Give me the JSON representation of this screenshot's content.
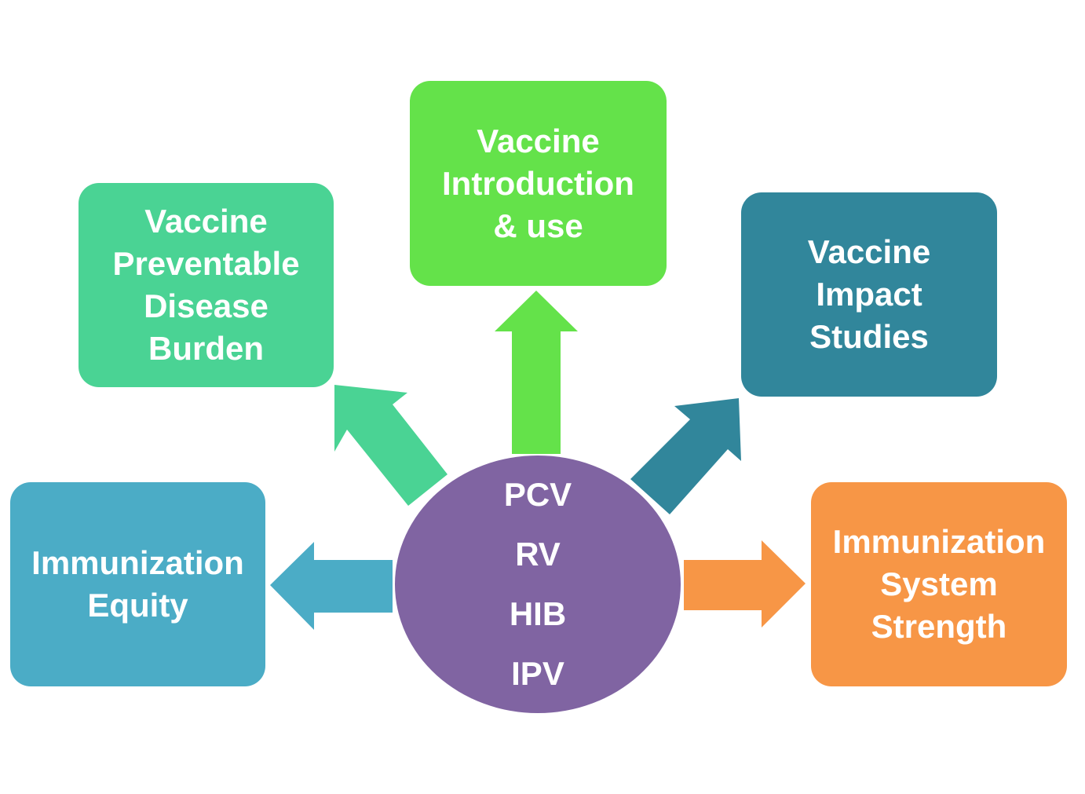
{
  "hub": {
    "items": [
      "PCV",
      "RV",
      "HIB",
      "IPV"
    ],
    "color": "#8064a2"
  },
  "boxes": {
    "burden": {
      "lines": [
        "Vaccine",
        "Preventable",
        "Disease",
        "Burden"
      ],
      "color": "#4ad394"
    },
    "intro": {
      "lines": [
        "Vaccine",
        "Introduction",
        "& use"
      ],
      "color": "#64e24a"
    },
    "impact": {
      "lines": [
        "Vaccine",
        "Impact",
        "Studies"
      ],
      "color": "#31869b"
    },
    "equity": {
      "lines": [
        "Immunization",
        "Equity"
      ],
      "color": "#4bacc6"
    },
    "system": {
      "lines": [
        "Immunization",
        "System",
        "Strength"
      ],
      "color": "#f79646"
    }
  }
}
